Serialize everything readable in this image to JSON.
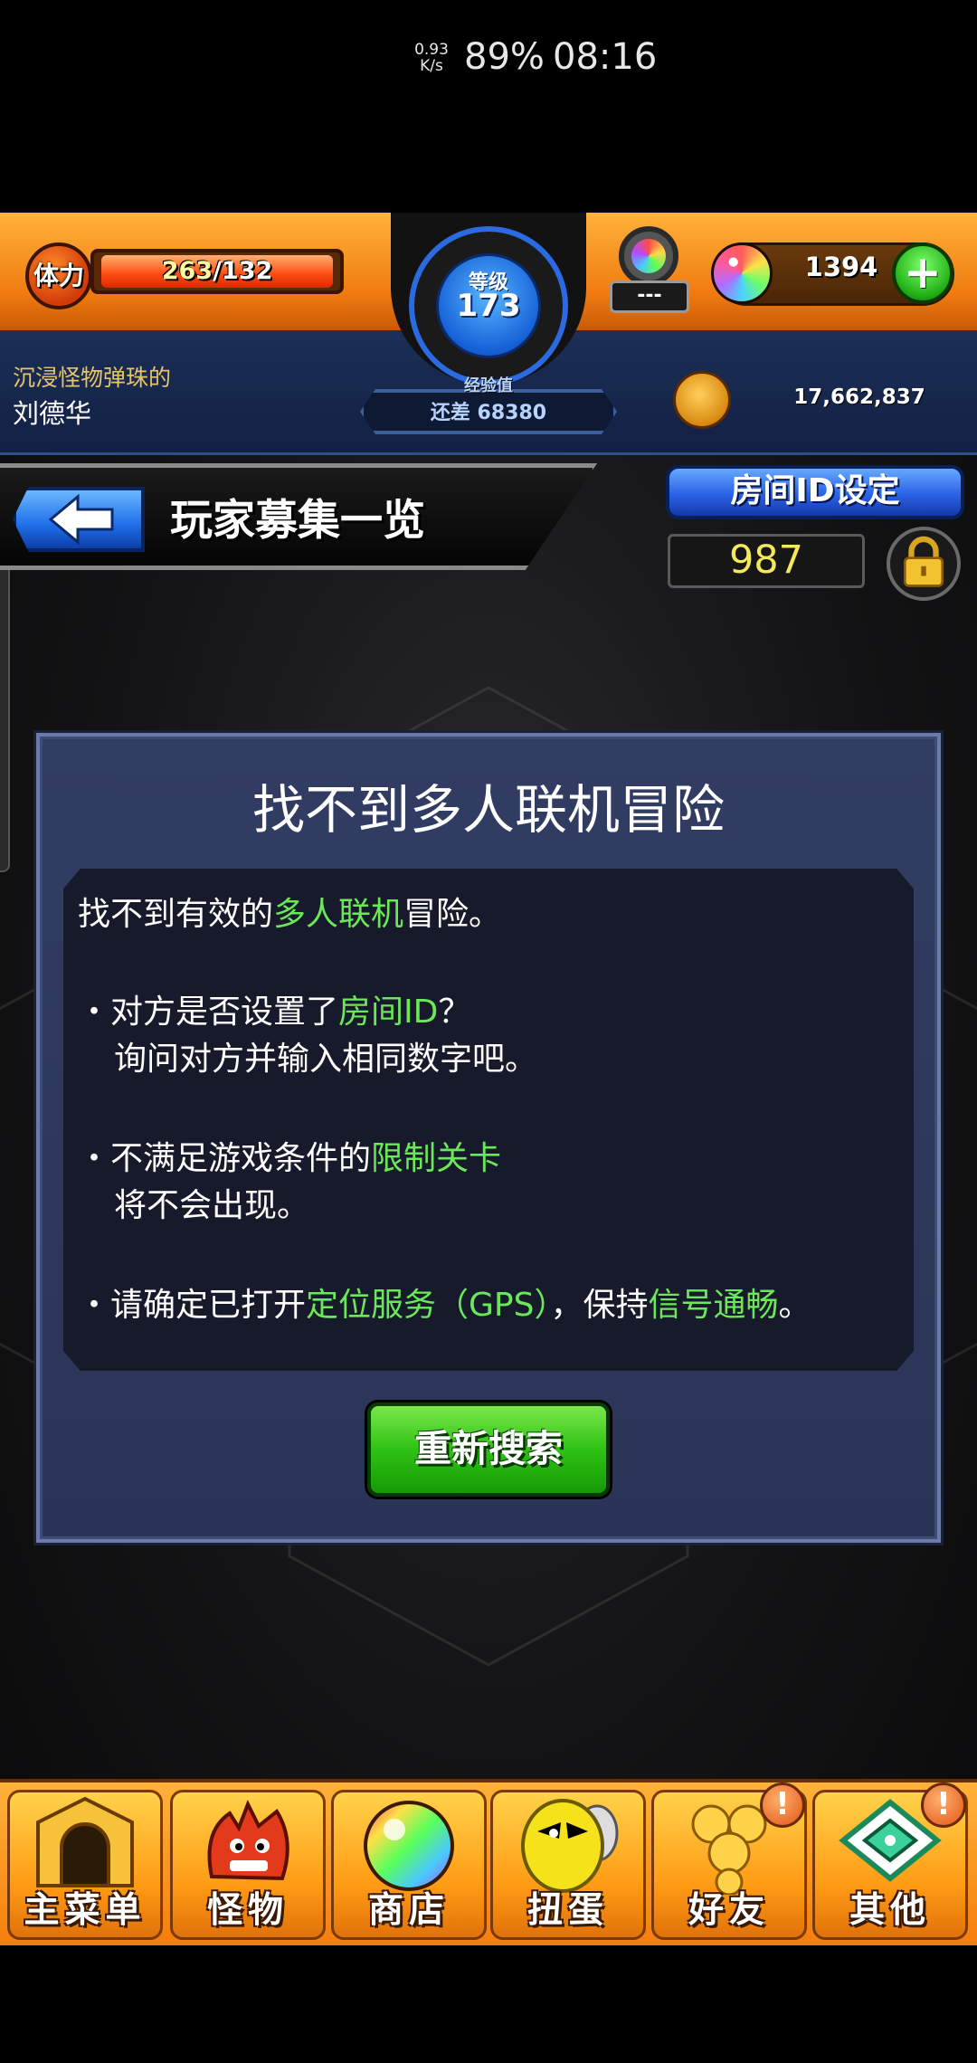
{
  "status_bar": {
    "net_speed_value": "0.93",
    "net_speed_unit": "K/s",
    "battery": "89%",
    "time": "08:16"
  },
  "hud": {
    "stamina_label": "体力",
    "stamina_current": "263",
    "stamina_max": "/132",
    "stamina_fill_fraction": 1.0,
    "rank_label": "等级",
    "rank_value": "173",
    "exp_label": "经验值",
    "exp_remaining": "还差 68380",
    "badge_value": "---",
    "orb_count": "1394",
    "orb_add": "+",
    "player_subtitle": "沉浸怪物弹珠的",
    "player_name": "刘德华",
    "coin_count": "17,662,837"
  },
  "header": {
    "page_title": "玩家募集一览",
    "room_id_button": "房间ID设定",
    "room_id_value": "987"
  },
  "dialog": {
    "title": "找不到多人联机冒险",
    "line1": {
      "a": "找不到有效的",
      "hl": "多人联机",
      "b": "冒险。"
    },
    "bullet1": {
      "a": "・对方是否设置了",
      "hl": "房间ID",
      "b": "？"
    },
    "bullet1_line2": "询问对方并输入相同数字吧。",
    "bullet2": {
      "a": "・不满足游戏条件的",
      "hl": "限制关卡",
      "b": ""
    },
    "bullet2_line2": "将不会出现。",
    "bullet3": {
      "a": "・请确定已打开",
      "hl1": "定位服务（GPS）",
      "mid": "，保持",
      "hl2": "信号通畅",
      "b": "。"
    },
    "search_again_button": "重新搜索"
  },
  "bottom_nav": {
    "items": [
      {
        "label": "主菜单",
        "icon": "gate-icon"
      },
      {
        "label": "怪物",
        "icon": "monster-icon"
      },
      {
        "label": "商店",
        "icon": "rainbow-orb-icon"
      },
      {
        "label": "扭蛋",
        "icon": "egg-icon"
      },
      {
        "label": "好友",
        "icon": "friends-icon"
      },
      {
        "label": "其他",
        "icon": "other-icon"
      }
    ],
    "alert_mark": "!"
  },
  "colors": {
    "hud_orange": "#f07a10",
    "highlight_green": "#6ae85a",
    "button_blue": "#2a62e6",
    "button_green": "#2ec214",
    "dialog_bg": "#2a3456"
  }
}
